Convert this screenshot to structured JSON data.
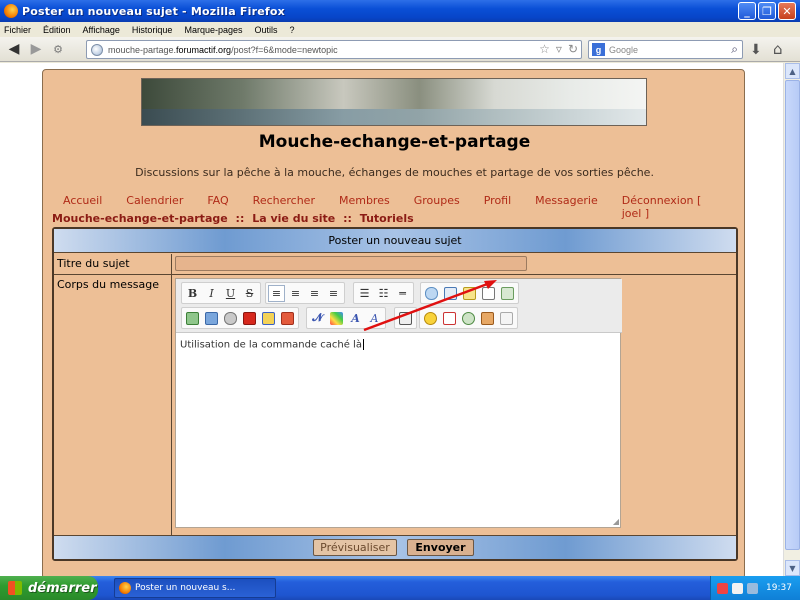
{
  "window": {
    "title": "Poster un nouveau sujet - Mozilla Firefox"
  },
  "menu": {
    "items": [
      "Fichier",
      "Édition",
      "Affichage",
      "Historique",
      "Marque-pages",
      "Outils",
      "?"
    ]
  },
  "nav": {
    "url_prefix": "mouche-partage.",
    "url_domain": "forumactif.org",
    "url_path": "/post?f=6&mode=newtopic",
    "search_placeholder": "Google"
  },
  "forum": {
    "site_name": "Mouche-echange-et-partage",
    "tagline": "Discussions sur la pêche à la mouche, échanges de mouches et partage de vos sorties pêche.",
    "links": [
      "Accueil",
      "Calendrier",
      "FAQ",
      "Rechercher",
      "Membres",
      "Groupes",
      "Profil",
      "Messagerie",
      "Déconnexion [ joel ]"
    ],
    "breadcrumb": [
      "Mouche-echange-et-partage",
      "La vie du site",
      "Tutoriels"
    ],
    "breadcrumb_sep": "::"
  },
  "post": {
    "header": "Poster un nouveau sujet",
    "subject_label": "Titre du sujet",
    "subject_value": "",
    "body_label": "Corps du message",
    "body_text": "Utilisation de la commande caché là",
    "preview_button": "Prévisualiser",
    "send_button": "Envoyer"
  },
  "toolbar": {
    "bold": "B",
    "italic": "I",
    "underline": "U",
    "strike": "S"
  },
  "taskbar": {
    "start": "démarrer",
    "task_label": "Poster un nouveau s...",
    "clock": "19:37"
  },
  "colors": {
    "accent_red": "#b02a17",
    "forum_bg": "#edbf96",
    "link_red": "#8b1b14"
  }
}
